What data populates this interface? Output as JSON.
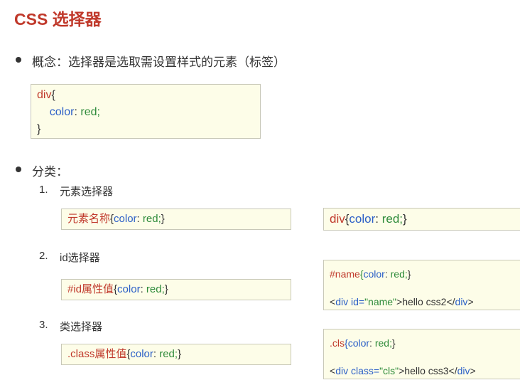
{
  "title": "CSS 选择器",
  "concept": {
    "text": "概念：选择器是选取需设置样式的元素（标签）",
    "code": [
      [
        {
          "t": "div",
          "c": "#c0392b"
        },
        {
          "t": "{",
          "c": "#333"
        }
      ],
      [
        {
          "t": "    ",
          "c": "#333"
        },
        {
          "t": "color",
          "c": "#2b5fc7"
        },
        {
          "t": ": ",
          "c": "#333"
        },
        {
          "t": "red;",
          "c": "#2e8b3a"
        }
      ],
      [
        {
          "t": "}",
          "c": "#333"
        }
      ]
    ]
  },
  "classification": {
    "label": "分类：",
    "items": [
      {
        "num": "1.",
        "label": "元素选择器",
        "syntax": [
          [
            {
              "t": "元素名称",
              "c": "#c0392b"
            },
            {
              "t": "{",
              "c": "#333"
            },
            {
              "t": "color",
              "c": "#2b5fc7"
            },
            {
              "t": ": ",
              "c": "#333"
            },
            {
              "t": "red;",
              "c": "#2e8b3a"
            },
            {
              "t": "}",
              "c": "#333"
            }
          ]
        ],
        "example": [
          [
            {
              "t": "div",
              "c": "#c0392b"
            },
            {
              "t": "{",
              "c": "#333"
            },
            {
              "t": "color",
              "c": "#2b5fc7"
            },
            {
              "t": ": ",
              "c": "#333"
            },
            {
              "t": "red;",
              "c": "#2e8b3a"
            },
            {
              "t": "}",
              "c": "#333"
            }
          ]
        ]
      },
      {
        "num": "2.",
        "label": "id选择器",
        "syntax": [
          [
            {
              "t": "#id属性值",
              "c": "#c0392b"
            },
            {
              "t": "{",
              "c": "#333"
            },
            {
              "t": "color",
              "c": "#2b5fc7"
            },
            {
              "t": ": ",
              "c": "#333"
            },
            {
              "t": "red;",
              "c": "#2e8b3a"
            },
            {
              "t": "}",
              "c": "#333"
            }
          ]
        ],
        "example": [
          [
            {
              "t": "#name",
              "c": "#c0392b"
            },
            {
              "t": "{",
              "c": "#2e8b3a"
            },
            {
              "t": "color",
              "c": "#2b5fc7"
            },
            {
              "t": ": ",
              "c": "#333"
            },
            {
              "t": "red;",
              "c": "#2e8b3a"
            },
            {
              "t": "}",
              "c": "#333"
            }
          ],
          [
            {
              "t": "<",
              "c": "#333"
            },
            {
              "t": "div",
              "c": "#2b5fc7"
            },
            {
              "t": " id=",
              "c": "#2b5fc7"
            },
            {
              "t": "\"name\"",
              "c": "#2e8b3a"
            },
            {
              "t": ">hello css2</",
              "c": "#333"
            },
            {
              "t": "div",
              "c": "#2b5fc7"
            },
            {
              "t": ">",
              "c": "#333"
            }
          ]
        ]
      },
      {
        "num": "3.",
        "label": "类选择器",
        "syntax": [
          [
            {
              "t": ".class属性值",
              "c": "#c0392b"
            },
            {
              "t": "{",
              "c": "#333"
            },
            {
              "t": "color",
              "c": "#2b5fc7"
            },
            {
              "t": ": ",
              "c": "#333"
            },
            {
              "t": "red;",
              "c": "#2e8b3a"
            },
            {
              "t": "}",
              "c": "#333"
            }
          ]
        ],
        "example": [
          [
            {
              "t": ".cls",
              "c": "#c0392b"
            },
            {
              "t": "{",
              "c": "#2b5fc7"
            },
            {
              "t": "color",
              "c": "#2b5fc7"
            },
            {
              "t": ": ",
              "c": "#333"
            },
            {
              "t": "red;",
              "c": "#2e8b3a"
            },
            {
              "t": "}",
              "c": "#333"
            }
          ],
          [
            {
              "t": "<",
              "c": "#333"
            },
            {
              "t": "div",
              "c": "#2b5fc7"
            },
            {
              "t": " class=",
              "c": "#2b5fc7"
            },
            {
              "t": "\"cls\"",
              "c": "#2e8b3a"
            },
            {
              "t": ">hello css3</",
              "c": "#333"
            },
            {
              "t": "div",
              "c": "#2b5fc7"
            },
            {
              "t": ">",
              "c": "#333"
            }
          ]
        ]
      }
    ]
  }
}
